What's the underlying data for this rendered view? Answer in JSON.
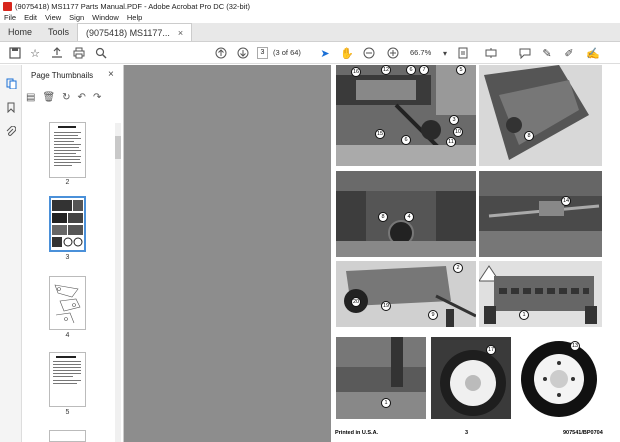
{
  "window": {
    "title": "(9075418) MS1177 Parts Manual.PDF - Adobe Acrobat Pro DC (32-bit)"
  },
  "menu": [
    "File",
    "Edit",
    "View",
    "Sign",
    "Window",
    "Help"
  ],
  "tabs": [
    {
      "label": "Home"
    },
    {
      "label": "Tools"
    },
    {
      "label": "(9075418) MS1177...",
      "close": "×"
    }
  ],
  "toolbar": {
    "page_value": "3",
    "page_count": "(3 of 64)",
    "zoom": "66.7%"
  },
  "panel": {
    "title": "Page Thumbnails",
    "close": "×",
    "thumbnails": [
      {
        "label": "2"
      },
      {
        "label": "3",
        "selected": true
      },
      {
        "label": "4"
      },
      {
        "label": "5"
      }
    ]
  },
  "document": {
    "footer_left": "Printed in U.S.A.",
    "footer_mid": "3",
    "footer_right": "907541/BP0704",
    "callouts": [
      "16",
      "12",
      "6",
      "7",
      "5",
      "3",
      "10",
      "11",
      "15",
      "6",
      "8",
      "8",
      "4",
      "14",
      "2",
      "20",
      "19",
      "9",
      "1",
      "17",
      "13",
      "1"
    ]
  },
  "colors": {
    "acrobat_red": "#d7261d",
    "canvas_gray": "#8d8d8d",
    "selected_thumb": "#4a90d9"
  }
}
